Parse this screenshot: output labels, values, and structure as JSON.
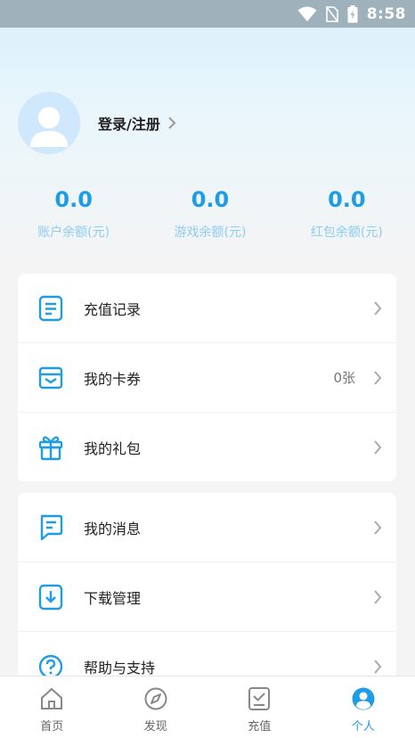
{
  "status_bar": {
    "time": "8:58"
  },
  "profile": {
    "login_label": "登录/注册"
  },
  "balances": [
    {
      "value": "0.0",
      "label": "账户余额(元)"
    },
    {
      "value": "0.0",
      "label": "游戏余额(元)"
    },
    {
      "value": "0.0",
      "label": "红包余额(元)"
    }
  ],
  "menu1": [
    {
      "label": "充值记录",
      "icon": "document-icon"
    },
    {
      "label": "我的卡券",
      "icon": "coupon-icon",
      "extra": "0张"
    },
    {
      "label": "我的礼包",
      "icon": "gift-icon"
    }
  ],
  "menu2": [
    {
      "label": "我的消息",
      "icon": "message-icon"
    },
    {
      "label": "下载管理",
      "icon": "download-icon"
    },
    {
      "label": "帮助与支持",
      "icon": "help-icon"
    }
  ],
  "tabs": [
    {
      "label": "首页",
      "icon": "home-icon"
    },
    {
      "label": "发现",
      "icon": "compass-icon"
    },
    {
      "label": "充值",
      "icon": "recharge-icon"
    },
    {
      "label": "个人",
      "icon": "person-icon",
      "active": true
    }
  ],
  "colors": {
    "accent": "#1e9ce6",
    "balance_label": "#8ecdf0"
  }
}
